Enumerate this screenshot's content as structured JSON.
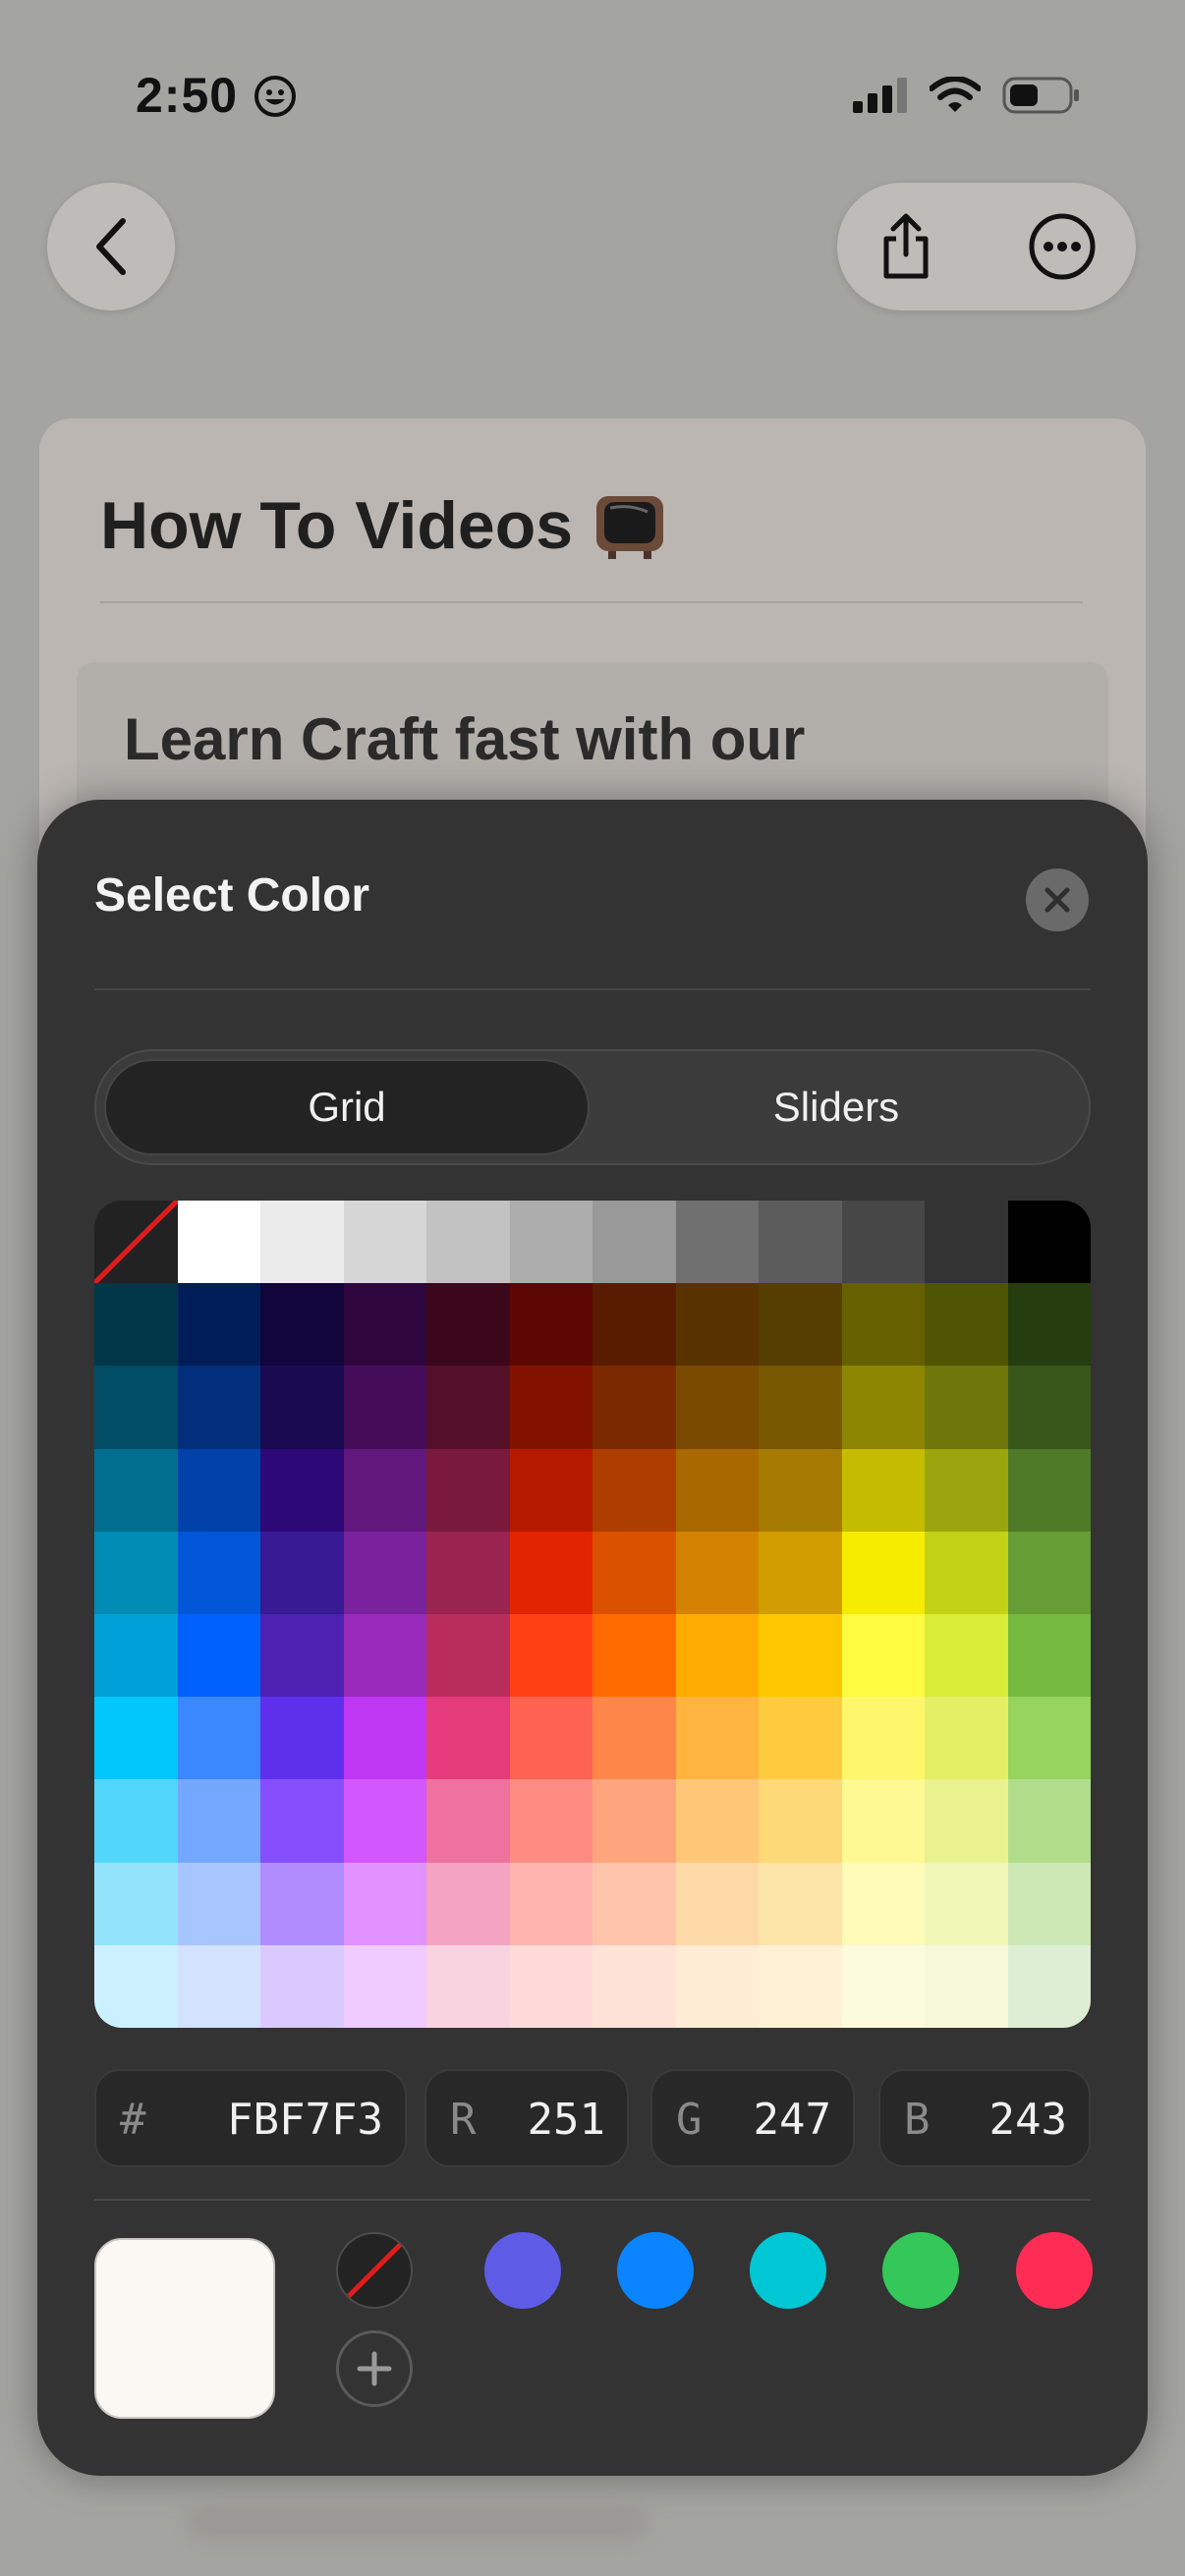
{
  "status_bar": {
    "time": "2:50"
  },
  "document": {
    "title": "How To Videos",
    "block_text": "Learn Craft fast with our"
  },
  "color_sheet": {
    "title": "Select Color",
    "tabs": [
      {
        "label": "Grid",
        "selected": true
      },
      {
        "label": "Sliders",
        "selected": false
      }
    ],
    "palette_rows": [
      [
        "none",
        "#FFFFFF",
        "#EBEBEB",
        "#D6D6D6",
        "#C2C2C2",
        "#ADADAD",
        "#999999",
        "#707070",
        "#5C5C5C",
        "#474747",
        "#333333",
        "#000000"
      ],
      [
        "#00384A",
        "#011D57",
        "#11053B",
        "#2E063D",
        "#3C071B",
        "#5C0701",
        "#5A1C00",
        "#583300",
        "#563D00",
        "#666100",
        "#4F5504",
        "#263E0F"
      ],
      [
        "#004D65",
        "#012F7B",
        "#1A0A52",
        "#450D59",
        "#551029",
        "#831100",
        "#7B2900",
        "#7A4A00",
        "#785800",
        "#8C8602",
        "#6F760A",
        "#38571A"
      ],
      [
        "#016E8F",
        "#0042A9",
        "#2C0977",
        "#61187C",
        "#791A3D",
        "#B51A00",
        "#AD3E00",
        "#A96800",
        "#A67B01",
        "#C4BC00",
        "#9BA50E",
        "#4E7A27"
      ],
      [
        "#008CB4",
        "#0056D6",
        "#371A94",
        "#7A219E",
        "#99244F",
        "#E22400",
        "#DA5100",
        "#D38301",
        "#D19D01",
        "#F5EC00",
        "#C3D117",
        "#669D34"
      ],
      [
        "#00A1D8",
        "#0061FE",
        "#4D22B2",
        "#982ABC",
        "#B92D5D",
        "#FF4015",
        "#FF6A00",
        "#FFAB01",
        "#FCC700",
        "#FEFB41",
        "#D9EC37",
        "#76BB40"
      ],
      [
        "#01C7FC",
        "#3A87FE",
        "#5E30EB",
        "#BE38F3",
        "#E63B7A",
        "#FE6250",
        "#FE8648",
        "#FEB43F",
        "#FECB3E",
        "#FFF76B",
        "#E4EF65",
        "#96D35F"
      ],
      [
        "#52D6FC",
        "#74A7FF",
        "#864FFE",
        "#D357FE",
        "#EE719E",
        "#FF8C82",
        "#FEA57D",
        "#FEC777",
        "#FED977",
        "#FFF994",
        "#EAF28F",
        "#B1DD8B"
      ],
      [
        "#93E3FC",
        "#A7C6FF",
        "#B18CFE",
        "#E292FE",
        "#F4A4C0",
        "#FFB5AF",
        "#FFC5AB",
        "#FED9A8",
        "#FDE4A8",
        "#FFFBB9",
        "#F1F7B7",
        "#CDE8B5"
      ],
      [
        "#CBF0FF",
        "#D3E2FF",
        "#D9C9FE",
        "#EFCAFE",
        "#F9D3E0",
        "#FFDAD8",
        "#FFE2D6",
        "#FEECD4",
        "#FEF1D5",
        "#FDFBDD",
        "#F6FADB",
        "#DEEED4"
      ]
    ],
    "hex": {
      "label": "#",
      "value": "FBF7F3"
    },
    "r": {
      "label": "R",
      "value": "251"
    },
    "g": {
      "label": "G",
      "value": "247"
    },
    "b": {
      "label": "B",
      "value": "243"
    },
    "selected_color": "#FBF7F3",
    "recent_colors": [
      "none",
      "#5E5CE6",
      "#0A84FF",
      "#00C7D4",
      "#34C759",
      "#FF2D55"
    ]
  }
}
